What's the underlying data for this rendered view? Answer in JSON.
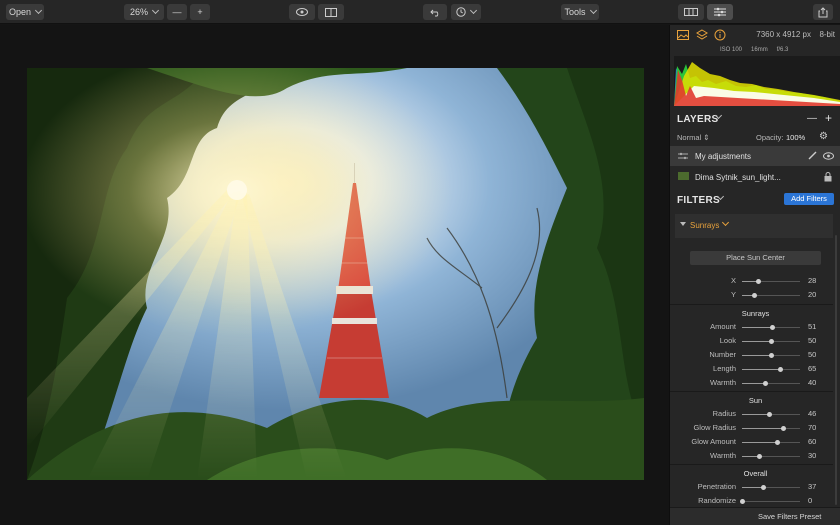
{
  "toolbar": {
    "open_label": "Open",
    "zoom_value": "26%",
    "zoom_out_symbol": "—",
    "zoom_in_symbol": "+",
    "tools_label": "Tools"
  },
  "info": {
    "dimensions": "7360 x 4912 px",
    "bit_depth": "8-bit",
    "exif": [
      "ISO 100",
      "16mm",
      "f/6.3"
    ]
  },
  "layers": {
    "title": "LAYERS",
    "minus_symbol": "—",
    "plus_symbol": "+",
    "blend_mode": "Normal",
    "opacity_label": "Opacity:",
    "opacity_value": "100%",
    "items": [
      {
        "name": "My adjustments"
      },
      {
        "name": "Dima Sytnik_sun_light..."
      }
    ]
  },
  "filters": {
    "title": "FILTERS",
    "add_label": "Add Filters",
    "active_filter": "Sunrays",
    "place_sun_label": "Place Sun Center",
    "sliders": [
      {
        "label": "X",
        "value": 28
      },
      {
        "label": "Y",
        "value": 20
      },
      {
        "label": "Amount",
        "value": 51
      },
      {
        "label": "Look",
        "value": 50
      },
      {
        "label": "Number",
        "value": 50
      },
      {
        "label": "Length",
        "value": 65
      },
      {
        "label": "Warmth",
        "value": 40
      },
      {
        "label": "Radius",
        "value": 46
      },
      {
        "label": "Glow Radius",
        "value": 70
      },
      {
        "label": "Glow Amount",
        "value": 60
      },
      {
        "label": "Warmth",
        "value": 30
      },
      {
        "label": "Penetration",
        "value": 37
      },
      {
        "label": "Randomize",
        "value": 0
      }
    ],
    "groups": {
      "sunrays": "Sunrays",
      "sun": "Sun",
      "overall": "Overall"
    },
    "save_preset_label": "Save Filters Preset"
  },
  "colors": {
    "accent_blue": "#2b75d6",
    "filter_orange": "#e8a23c",
    "panel_bg": "#262626",
    "canvas_bg": "#141414"
  }
}
